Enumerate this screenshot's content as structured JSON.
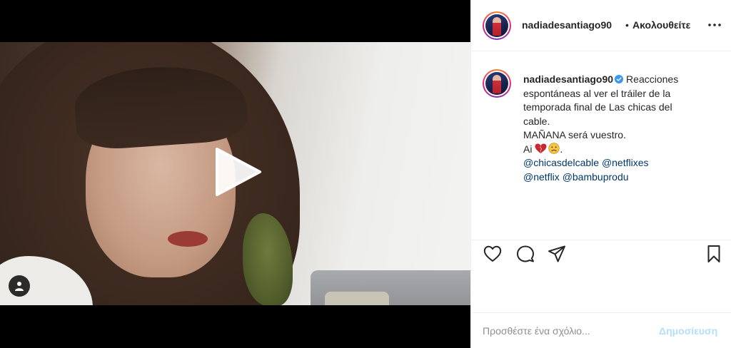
{
  "post": {
    "video": {
      "play_icon": "play-icon",
      "tag_icon": "person-tag-icon"
    },
    "header": {
      "username": "nadiadesantiago90",
      "separator": "•",
      "follow_label": "Ακολουθείτε",
      "more_icon": "more-options-icon"
    },
    "caption": {
      "username": "nadiadesantiago90",
      "verified_icon": "verified-badge-icon",
      "line1": "Reacciones",
      "line2": "espontáneas al ver el tráiler de la",
      "line3": "temporada final de Las chicas del",
      "line4": "cable.",
      "line5": "MAÑANA será vuestro.",
      "line6": "Ai",
      "line6_tail": ".",
      "mention1": "@chicasdelcable",
      "mention2": "@netflixes",
      "mention3": "@netflix",
      "mention4": "@bambuprodu"
    },
    "actions": {
      "like_icon": "heart-icon",
      "comment_icon": "comment-icon",
      "share_icon": "share-icon",
      "save_icon": "bookmark-icon"
    },
    "comment": {
      "placeholder": "Προσθέστε ένα σχόλιο...",
      "publish_label": "Δημοσίευση"
    },
    "colors": {
      "link": "#00376b",
      "publish_disabled": "#b2dffc",
      "verified": "#3897f0"
    }
  }
}
